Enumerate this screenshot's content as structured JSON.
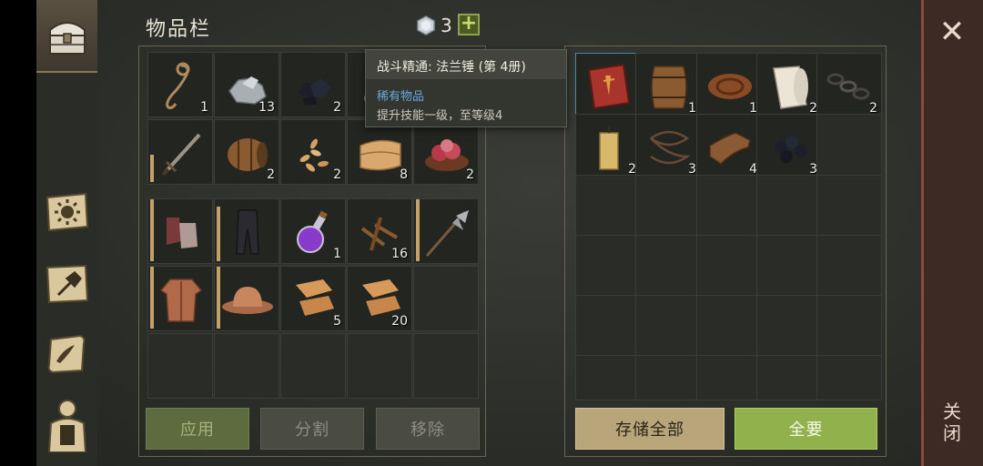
{
  "header": {
    "title": "物品栏",
    "gem_count": "3",
    "plus_label": "+"
  },
  "tooltip": {
    "title": "战斗精通: 法兰锤 (第 4册)",
    "rarity": "稀有物品",
    "description": "提升技能一级，至等级4"
  },
  "inventory": {
    "row1": [
      {
        "icon": "rope-icon",
        "count": "1"
      },
      {
        "icon": "stone-icon",
        "count": "13"
      },
      {
        "icon": "coal-icon",
        "count": "2"
      },
      {
        "icon": "iron-ore-icon",
        "count": ""
      },
      {
        "icon": "hidden-item-icon",
        "count": ""
      }
    ],
    "row2": [
      {
        "icon": "sword-icon",
        "count": ""
      },
      {
        "icon": "barrel-icon",
        "count": "2"
      },
      {
        "icon": "seeds-icon",
        "count": "2"
      },
      {
        "icon": "cloth-icon",
        "count": "8"
      },
      {
        "icon": "meat-bowl-icon",
        "count": "2"
      }
    ],
    "row3": [
      {
        "icon": "gloves-icon",
        "count": ""
      },
      {
        "icon": "pants-icon",
        "count": ""
      },
      {
        "icon": "potion-icon",
        "count": "1"
      },
      {
        "icon": "nails-icon",
        "count": "16"
      },
      {
        "icon": "halberd-icon",
        "count": ""
      }
    ],
    "row4": [
      {
        "icon": "armor-icon",
        "count": ""
      },
      {
        "icon": "helmet-icon",
        "count": ""
      },
      {
        "icon": "scarf-icon",
        "count": "5"
      },
      {
        "icon": "scarf-icon",
        "count": "20"
      }
    ]
  },
  "storage": {
    "row1": [
      {
        "icon": "red-book-icon",
        "count": ""
      },
      {
        "icon": "barrel-icon",
        "count": "1"
      },
      {
        "icon": "leather-roll-icon",
        "count": "1"
      },
      {
        "icon": "paper-roll-icon",
        "count": "2"
      },
      {
        "icon": "chain-icon",
        "count": "2"
      }
    ],
    "row2": [
      {
        "icon": "candle-icon",
        "count": "2"
      },
      {
        "icon": "wire-icon",
        "count": "3"
      },
      {
        "icon": "leather-icon",
        "count": "4"
      },
      {
        "icon": "coal-icon",
        "count": "3"
      }
    ]
  },
  "buttons": {
    "apply": "应用",
    "split": "分割",
    "remove": "移除",
    "store_all": "存储全部",
    "take_all": "全要",
    "close_vertical": "关闭"
  },
  "colors": {
    "accent_green": "#91b14d",
    "store_gold": "#b9a57a",
    "rarity_blue": "#6aa8de",
    "close_strip": "#3e2a24"
  }
}
